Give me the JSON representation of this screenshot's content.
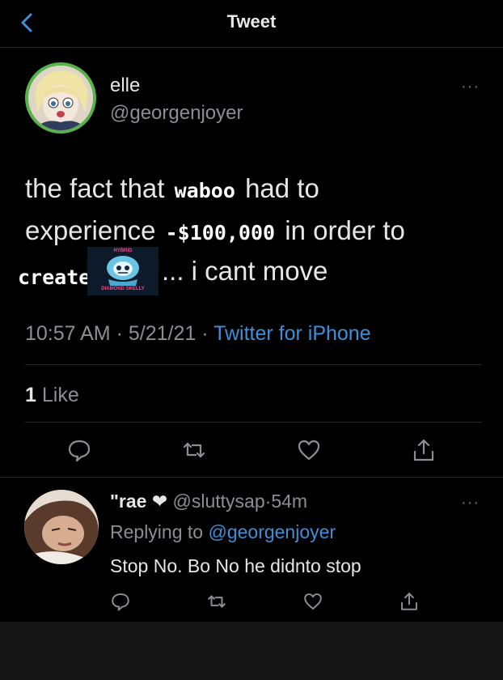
{
  "nav": {
    "title": "Tweet"
  },
  "tweet": {
    "author_name": "elle",
    "author_handle": "@georgenjoyer",
    "line1_prefix": "the fact that",
    "caption_waboo": "waboo",
    "line1_suffix": "had to",
    "line2_prefix": "experience",
    "caption_amount": "-$100,000",
    "line2_suffix": "in order to",
    "caption_create": "create",
    "sticker_top": "HYBRID",
    "sticker_bottom": "DIAMOND SKELLY",
    "line3_suffix": "... i cant move",
    "time": "10:57 AM",
    "date": "5/21/21",
    "source": "Twitter for iPhone",
    "like_count": "1",
    "like_label": "Like",
    "more": "···"
  },
  "reply": {
    "name": "\"rae",
    "heart": "❤",
    "handle": "@sluttysap",
    "age": "54m",
    "replying_prefix": "Replying to",
    "replying_handle": "@georgenjoyer",
    "text": "Stop No. Bo No he didnto stop",
    "more": "···"
  },
  "colors": {
    "background": "#000000",
    "link": "#3d8fd8",
    "muted": "#8b8f93",
    "avatar_ring": "#58b14a"
  },
  "icons": [
    "back-chevron-icon",
    "reply-icon",
    "retweet-icon",
    "like-icon",
    "share-icon",
    "more-icon"
  ]
}
